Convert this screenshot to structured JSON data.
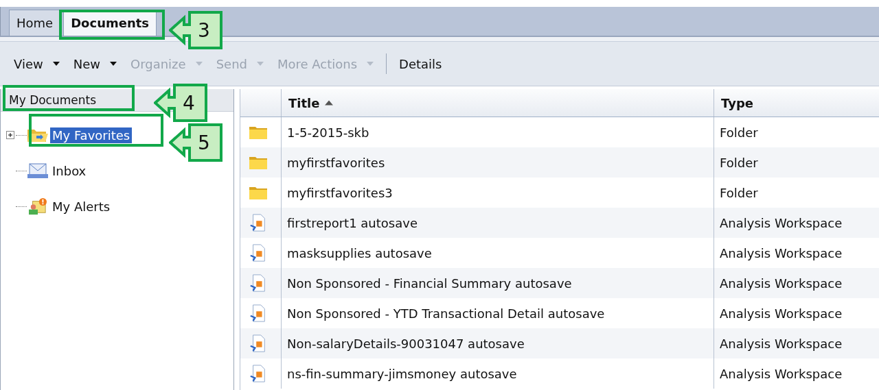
{
  "tabs": [
    {
      "label": "Home",
      "selected": false
    },
    {
      "label": "Documents",
      "selected": true
    }
  ],
  "toolbar": {
    "items": [
      {
        "label": "View",
        "disabled": false
      },
      {
        "label": "New",
        "disabled": false
      },
      {
        "label": "Organize",
        "disabled": true
      },
      {
        "label": "Send",
        "disabled": true
      },
      {
        "label": "More Actions",
        "disabled": true
      }
    ],
    "details": "Details"
  },
  "sidebar": {
    "title": "My Documents",
    "items": [
      {
        "kind": "favorites",
        "label": "My Favorites",
        "selected": true,
        "expanded": false
      },
      {
        "kind": "inbox",
        "label": "Inbox",
        "selected": false
      },
      {
        "kind": "alerts",
        "label": "My Alerts",
        "selected": false
      }
    ]
  },
  "table": {
    "columns": [
      {
        "label": "Title",
        "sorted": true
      },
      {
        "label": "Type",
        "sorted": false
      }
    ],
    "rows": [
      {
        "kind": "folder",
        "title": "1-5-2015-skb",
        "type": "Folder"
      },
      {
        "kind": "folder",
        "title": "myfirstfavorites",
        "type": "Folder"
      },
      {
        "kind": "folder",
        "title": "myfirstfavorites3",
        "type": "Folder"
      },
      {
        "kind": "workspace",
        "title": "firstreport1 autosave",
        "type": "Analysis Workspace"
      },
      {
        "kind": "workspace",
        "title": "masksupplies autosave",
        "type": "Analysis Workspace"
      },
      {
        "kind": "workspace",
        "title": "Non Sponsored - Financial Summary autosave",
        "type": "Analysis Workspace"
      },
      {
        "kind": "workspace",
        "title": "Non Sponsored - YTD Transactional Detail autosave",
        "type": "Analysis Workspace"
      },
      {
        "kind": "workspace",
        "title": "Non-salaryDetails-90031047 autosave",
        "type": "Analysis Workspace"
      },
      {
        "kind": "workspace",
        "title": "ns-fin-summary-jimsmoney autosave",
        "type": "Analysis Workspace"
      }
    ]
  },
  "callouts": [
    {
      "number": "3"
    },
    {
      "number": "4"
    },
    {
      "number": "5"
    }
  ]
}
